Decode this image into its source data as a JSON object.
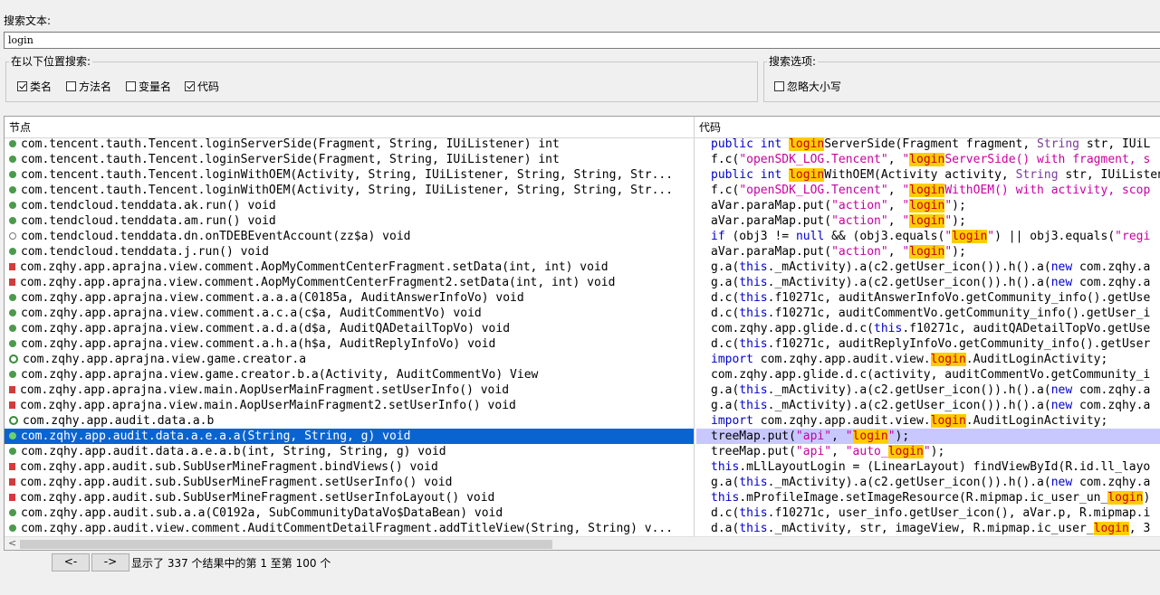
{
  "search": {
    "label": "搜索文本:",
    "value": "login"
  },
  "scope": {
    "title": "在以下位置搜索:",
    "options": [
      {
        "label": "类名",
        "checked": true
      },
      {
        "label": "方法名",
        "checked": false
      },
      {
        "label": "变量名",
        "checked": false
      },
      {
        "label": "代码",
        "checked": true
      }
    ]
  },
  "search_options": {
    "title": "搜索选项:",
    "ignore_case": {
      "label": "忽略大小写",
      "checked": false
    }
  },
  "results": {
    "col_node": "节点",
    "col_code": "代码",
    "selected_index": 19,
    "nodes": [
      {
        "icon": "method",
        "text": "com.tencent.tauth.Tencent.loginServerSide(Fragment, String, IUiListener) int"
      },
      {
        "icon": "method",
        "text": "com.tencent.tauth.Tencent.loginServerSide(Fragment, String, IUiListener) int"
      },
      {
        "icon": "method",
        "text": "com.tencent.tauth.Tencent.loginWithOEM(Activity, String, IUiListener, String, String, Str..."
      },
      {
        "icon": "method",
        "text": "com.tencent.tauth.Tencent.loginWithOEM(Activity, String, IUiListener, String, String, Str..."
      },
      {
        "icon": "method",
        "text": "com.tendcloud.tenddata.ak.run() void"
      },
      {
        "icon": "method",
        "text": "com.tendcloud.tenddata.am.run() void"
      },
      {
        "icon": "static",
        "text": "com.tendcloud.tenddata.dn.onTDEBEventAccount(zz$a) void"
      },
      {
        "icon": "method",
        "text": "com.tendcloud.tenddata.j.run() void"
      },
      {
        "icon": "private",
        "text": "com.zqhy.app.aprajna.view.comment.AopMyCommentCenterFragment.setData(int, int) void"
      },
      {
        "icon": "private",
        "text": "com.zqhy.app.aprajna.view.comment.AopMyCommentCenterFragment2.setData(int, int) void"
      },
      {
        "icon": "method",
        "text": "com.zqhy.app.aprajna.view.comment.a.a.a(C0185a, AuditAnswerInfoVo) void"
      },
      {
        "icon": "method",
        "text": "com.zqhy.app.aprajna.view.comment.a.c.a(c$a, AuditCommentVo) void"
      },
      {
        "icon": "method",
        "text": "com.zqhy.app.aprajna.view.comment.a.d.a(d$a, AuditQADetailTopVo) void"
      },
      {
        "icon": "method",
        "text": "com.zqhy.app.aprajna.view.comment.a.h.a(h$a, AuditReplyInfoVo) void"
      },
      {
        "icon": "class",
        "text": "com.zqhy.app.aprajna.view.game.creator.a"
      },
      {
        "icon": "method",
        "text": "com.zqhy.app.aprajna.view.game.creator.b.a(Activity, AuditCommentVo) View"
      },
      {
        "icon": "private",
        "text": "com.zqhy.app.aprajna.view.main.AopUserMainFragment.setUserInfo() void"
      },
      {
        "icon": "private",
        "text": "com.zqhy.app.aprajna.view.main.AopUserMainFragment2.setUserInfo() void"
      },
      {
        "icon": "class",
        "text": "com.zqhy.app.audit.data.a.b"
      },
      {
        "icon": "method",
        "text": "com.zqhy.app.audit.data.a.e.a.a(String, String, g) void"
      },
      {
        "icon": "method",
        "text": "com.zqhy.app.audit.data.a.e.a.b(int, String, String, g) void"
      },
      {
        "icon": "private",
        "text": "com.zqhy.app.audit.sub.SubUserMineFragment.bindViews() void"
      },
      {
        "icon": "private",
        "text": "com.zqhy.app.audit.sub.SubUserMineFragment.setUserInfo() void"
      },
      {
        "icon": "private",
        "text": "com.zqhy.app.audit.sub.SubUserMineFragment.setUserInfoLayout() void"
      },
      {
        "icon": "method",
        "text": "com.zqhy.app.audit.sub.a.a(C0192a, SubCommunityDataVo$DataBean) void"
      },
      {
        "icon": "method",
        "text": "com.zqhy.app.audit.view.comment.AuditCommentDetailFragment.addTitleView(String, String) v..."
      }
    ],
    "code": [
      [
        {
          "t": "public int ",
          "c": "kw"
        },
        {
          "t": "login",
          "c": "match"
        },
        {
          "t": "ServerSide(Fragment fragment, "
        },
        {
          "t": "String",
          "c": "type"
        },
        {
          "t": " str, IUiL"
        }
      ],
      [
        {
          "t": "f.c("
        },
        {
          "t": "\"openSDK_LOG.Tencent\"",
          "c": "str"
        },
        {
          "t": ", "
        },
        {
          "t": "\"",
          "c": "str"
        },
        {
          "t": "login",
          "c": "match"
        },
        {
          "t": "ServerSide() with fragment, s",
          "c": "str"
        }
      ],
      [
        {
          "t": "public int ",
          "c": "kw"
        },
        {
          "t": "login",
          "c": "match"
        },
        {
          "t": "WithOEM(Activity activity, "
        },
        {
          "t": "String",
          "c": "type"
        },
        {
          "t": " str, IUiListener"
        }
      ],
      [
        {
          "t": "f.c("
        },
        {
          "t": "\"openSDK_LOG.Tencent\"",
          "c": "str"
        },
        {
          "t": ", "
        },
        {
          "t": "\"",
          "c": "str"
        },
        {
          "t": "login",
          "c": "match"
        },
        {
          "t": "WithOEM() with activity, scop",
          "c": "str"
        }
      ],
      [
        {
          "t": "aVar.paraMap.put("
        },
        {
          "t": "\"action\"",
          "c": "str"
        },
        {
          "t": ", "
        },
        {
          "t": "\"",
          "c": "str"
        },
        {
          "t": "login",
          "c": "match"
        },
        {
          "t": "\"",
          "c": "str"
        },
        {
          "t": ");"
        }
      ],
      [
        {
          "t": "aVar.paraMap.put("
        },
        {
          "t": "\"action\"",
          "c": "str"
        },
        {
          "t": ", "
        },
        {
          "t": "\"",
          "c": "str"
        },
        {
          "t": "login",
          "c": "match"
        },
        {
          "t": "\"",
          "c": "str"
        },
        {
          "t": ");"
        }
      ],
      [
        {
          "t": "if",
          "c": "kw"
        },
        {
          "t": " (obj3 != "
        },
        {
          "t": "null",
          "c": "kw"
        },
        {
          "t": " && (obj3.equals("
        },
        {
          "t": "\"",
          "c": "str"
        },
        {
          "t": "login",
          "c": "match"
        },
        {
          "t": "\"",
          "c": "str"
        },
        {
          "t": ") || obj3.equals("
        },
        {
          "t": "\"regi",
          "c": "str"
        }
      ],
      [
        {
          "t": "aVar.paraMap.put("
        },
        {
          "t": "\"action\"",
          "c": "str"
        },
        {
          "t": ", "
        },
        {
          "t": "\"",
          "c": "str"
        },
        {
          "t": "login",
          "c": "match"
        },
        {
          "t": "\"",
          "c": "str"
        },
        {
          "t": ");"
        }
      ],
      [
        {
          "t": "g.a("
        },
        {
          "t": "this",
          "c": "kw"
        },
        {
          "t": "._mActivity).a(c2.getUser_icon()).h().a("
        },
        {
          "t": "new",
          "c": "kw"
        },
        {
          "t": " com.zqhy.a"
        }
      ],
      [
        {
          "t": "g.a("
        },
        {
          "t": "this",
          "c": "kw"
        },
        {
          "t": "._mActivity).a(c2.getUser_icon()).h().a("
        },
        {
          "t": "new",
          "c": "kw"
        },
        {
          "t": " com.zqhy.a"
        }
      ],
      [
        {
          "t": "d.c("
        },
        {
          "t": "this",
          "c": "kw"
        },
        {
          "t": ".f10271c, auditAnswerInfoVo.getCommunity_info().getUse"
        }
      ],
      [
        {
          "t": "d.c("
        },
        {
          "t": "this",
          "c": "kw"
        },
        {
          "t": ".f10271c, auditCommentVo.getCommunity_info().getUser_i"
        }
      ],
      [
        {
          "t": "com.zqhy.app.glide.d.c("
        },
        {
          "t": "this",
          "c": "kw"
        },
        {
          "t": ".f10271c, auditQADetailTopVo.getUse"
        }
      ],
      [
        {
          "t": "d.c("
        },
        {
          "t": "this",
          "c": "kw"
        },
        {
          "t": ".f10271c, auditReplyInfoVo.getCommunity_info().getUser"
        }
      ],
      [
        {
          "t": "import",
          "c": "kw"
        },
        {
          "t": " com.zqhy.app.audit.view."
        },
        {
          "t": "login",
          "c": "match"
        },
        {
          "t": ".AuditLoginActivity;"
        }
      ],
      [
        {
          "t": "com.zqhy.app.glide.d.c(activity, auditCommentVo.getCommunity_i"
        }
      ],
      [
        {
          "t": "g.a("
        },
        {
          "t": "this",
          "c": "kw"
        },
        {
          "t": "._mActivity).a(c2.getUser_icon()).h().a("
        },
        {
          "t": "new",
          "c": "kw"
        },
        {
          "t": " com.zqhy.a"
        }
      ],
      [
        {
          "t": "g.a("
        },
        {
          "t": "this",
          "c": "kw"
        },
        {
          "t": "._mActivity).a(c2.getUser_icon()).h().a("
        },
        {
          "t": "new",
          "c": "kw"
        },
        {
          "t": " com.zqhy.a"
        }
      ],
      [
        {
          "t": "import",
          "c": "kw"
        },
        {
          "t": " com.zqhy.app.audit.view."
        },
        {
          "t": "login",
          "c": "match"
        },
        {
          "t": ".AuditLoginActivity;"
        }
      ],
      [
        {
          "t": "treeMap.put("
        },
        {
          "t": "\"api\"",
          "c": "str"
        },
        {
          "t": ", "
        },
        {
          "t": "\"",
          "c": "str"
        },
        {
          "t": "login",
          "c": "match"
        },
        {
          "t": "\"",
          "c": "str"
        },
        {
          "t": ");"
        }
      ],
      [
        {
          "t": "treeMap.put("
        },
        {
          "t": "\"api\"",
          "c": "str"
        },
        {
          "t": ", "
        },
        {
          "t": "\"auto_",
          "c": "str"
        },
        {
          "t": "login",
          "c": "match"
        },
        {
          "t": "\"",
          "c": "str"
        },
        {
          "t": ");"
        }
      ],
      [
        {
          "t": "this",
          "c": "kw"
        },
        {
          "t": ".mLlLayoutLogin = (LinearLayout) findViewById(R.id.ll_layo"
        }
      ],
      [
        {
          "t": "g.a("
        },
        {
          "t": "this",
          "c": "kw"
        },
        {
          "t": "._mActivity).a(c2.getUser_icon()).h().a("
        },
        {
          "t": "new",
          "c": "kw"
        },
        {
          "t": " com.zqhy.a"
        }
      ],
      [
        {
          "t": "this",
          "c": "kw"
        },
        {
          "t": ".mProfileImage.setImageResource(R.mipmap.ic_user_un_"
        },
        {
          "t": "login",
          "c": "match"
        },
        {
          "t": ")"
        }
      ],
      [
        {
          "t": "d.c("
        },
        {
          "t": "this",
          "c": "kw"
        },
        {
          "t": ".f10271c, user_info.getUser_icon(), aVar.p, R.mipmap.i"
        }
      ],
      [
        {
          "t": "d.a("
        },
        {
          "t": "this",
          "c": "kw"
        },
        {
          "t": "._mActivity, str, imageView, R.mipmap.ic_user_"
        },
        {
          "t": "login",
          "c": "match"
        },
        {
          "t": ", 3"
        }
      ]
    ]
  },
  "pager": {
    "prev_label": "<-",
    "next_label": "->",
    "status": "显示了 337 个结果中的第 1 至第 100 个"
  }
}
